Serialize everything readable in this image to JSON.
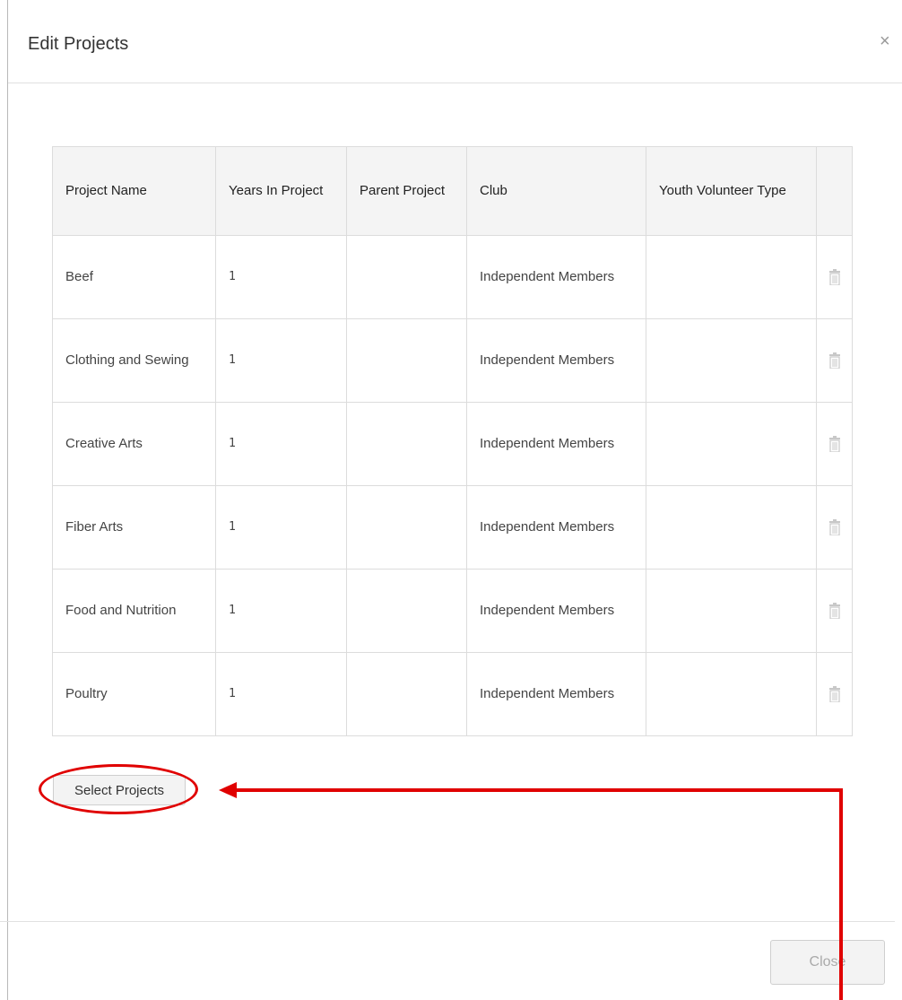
{
  "dialog": {
    "title": "Edit Projects",
    "close_symbol": "×"
  },
  "table": {
    "headers": {
      "project_name": "Project Name",
      "years_in_project": "Years In Project",
      "parent_project": "Parent Project",
      "club": "Club",
      "youth_volunteer_type": "Youth Volunteer Type"
    },
    "rows": [
      {
        "project_name": "Beef",
        "years": "1",
        "parent": "",
        "club": "Independent Members",
        "volunteer_type": ""
      },
      {
        "project_name": "Clothing and Sewing",
        "years": "1",
        "parent": "",
        "club": "Independent Members",
        "volunteer_type": ""
      },
      {
        "project_name": "Creative Arts",
        "years": "1",
        "parent": "",
        "club": "Independent Members",
        "volunteer_type": ""
      },
      {
        "project_name": "Fiber Arts",
        "years": "1",
        "parent": "",
        "club": "Independent Members",
        "volunteer_type": ""
      },
      {
        "project_name": "Food and Nutrition",
        "years": "1",
        "parent": "",
        "club": "Independent Members",
        "volunteer_type": ""
      },
      {
        "project_name": "Poultry",
        "years": "1",
        "parent": "",
        "club": "Independent Members",
        "volunteer_type": ""
      }
    ],
    "row_action_icon": "trash-icon"
  },
  "buttons": {
    "select_projects": "Select Projects",
    "close": "Close"
  },
  "annotation": {
    "color": "#e00000",
    "shape": "ellipse-with-arrow"
  }
}
